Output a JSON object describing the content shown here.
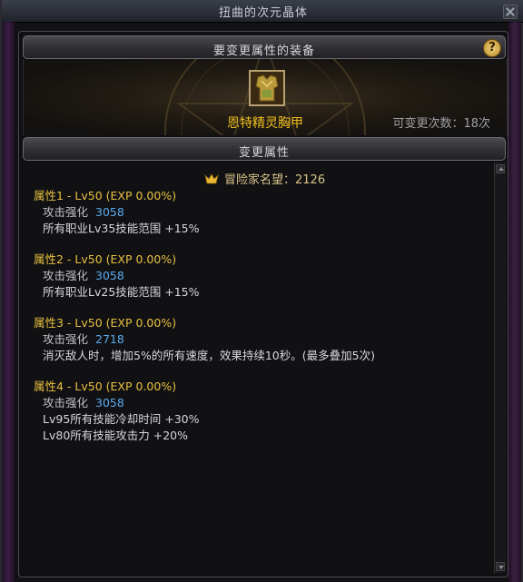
{
  "window": {
    "title": "扭曲的次元晶体"
  },
  "equip_section": {
    "header": "要变更属性的装备",
    "help": "?",
    "item_name": "恩特精灵胸甲",
    "change_count": "可变更次数：18次"
  },
  "attr_section": {
    "header": "变更属性",
    "fame": "冒险家名望：2126",
    "options": [
      {
        "title": "属性1 - Lv50 (EXP 0.00%)",
        "stat_label": "攻击强化",
        "stat_value": "3058",
        "lines": [
          "所有职业Lv35技能范围 +15%"
        ]
      },
      {
        "title": "属性2 - Lv50 (EXP 0.00%)",
        "stat_label": "攻击强化",
        "stat_value": "3058",
        "lines": [
          "所有职业Lv25技能范围 +15%"
        ]
      },
      {
        "title": "属性3 - Lv50 (EXP 0.00%)",
        "stat_label": "攻击强化",
        "stat_value": "2718",
        "lines": [
          "消灭敌人时，增加5%的所有速度，效果持续10秒。(最多叠加5次)"
        ]
      },
      {
        "title": "属性4 - Lv50 (EXP 0.00%)",
        "stat_label": "攻击强化",
        "stat_value": "3058",
        "lines": [
          "Lv95所有技能冷却时间 +30%",
          "Lv80所有技能攻击力 +20%"
        ]
      }
    ]
  },
  "icons": {
    "close": "close-icon",
    "help": "help-icon",
    "fame": "fame-icon",
    "equip": "chest-armor-icon",
    "scroll_up": "arrow-up-icon",
    "scroll_down": "arrow-down-icon"
  },
  "colors": {
    "item_name": "#f0c020",
    "attr_title": "#e8c040",
    "stat_value": "#5aaaf0",
    "text": "#d8d8dc"
  }
}
